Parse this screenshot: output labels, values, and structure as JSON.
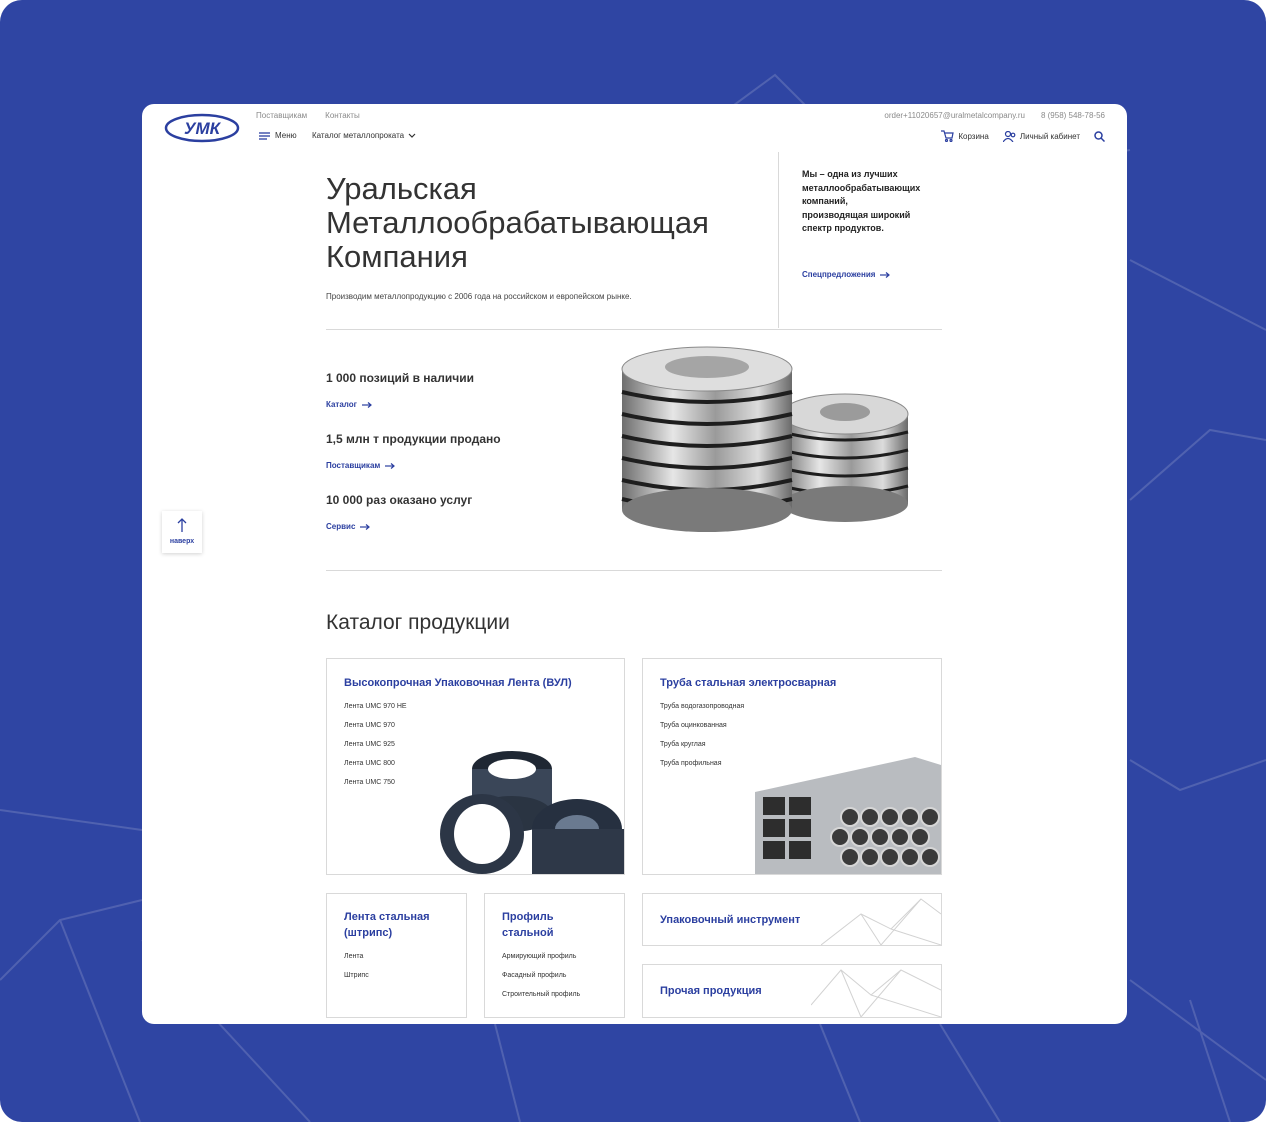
{
  "header": {
    "logo_text": "УМК",
    "top_links": [
      "Поставщикам",
      "Контакты"
    ],
    "email": "order+11020657@uralmetalcompany.ru",
    "phone": "8 (958) 548-78-56",
    "menu_label": "Меню",
    "catalog_label": "Каталог металлопроката",
    "cart_label": "Корзина",
    "account_label": "Личный кабинет"
  },
  "hero": {
    "title": "Уральская Металлообрабатывающая Компания",
    "subtitle": "Производим металлопродукцию с 2006 года на российском и европейском рынке.",
    "aside_text": "Мы – одна из лучших металлообрабатывающих компаний, производящая широкий спектр продуктов.",
    "aside_link": "Спецпредложения"
  },
  "stats": [
    {
      "title": "1 000 позиций в наличии",
      "link": "Каталог"
    },
    {
      "title": "1,5 млн т продукции продано",
      "link": "Поставщикам"
    },
    {
      "title": "10 000 раз оказано услуг",
      "link": "Сервис"
    }
  ],
  "back_to_top": "наверх",
  "catalog": {
    "title": "Каталог продукции",
    "cards": [
      {
        "title": "Высокопрочная Упаковочная Лента (ВУЛ)",
        "items": [
          "Лента UMC 970 HE",
          "Лента UMC 970",
          "Лента UMC 925",
          "Лента UMC 800",
          "Лента UMC 750"
        ]
      },
      {
        "title": "Труба стальная электросварная",
        "items": [
          "Труба водогазопроводная",
          "Труба оцинкованная",
          "Труба круглая",
          "Труба профильная"
        ]
      },
      {
        "title": "Лента стальная (штрипс)",
        "items": [
          "Лента",
          "Штрипс"
        ]
      },
      {
        "title": "Профиль стальной",
        "items": [
          "Армирующий профиль",
          "Фасадный профиль",
          "Строительный профиль"
        ]
      },
      {
        "title": "Упаковочный инструмент",
        "items": []
      },
      {
        "title": "Прочая продукция",
        "items": []
      }
    ]
  },
  "colors": {
    "brand": "#2b3fa0",
    "background": "#2f45a3"
  }
}
